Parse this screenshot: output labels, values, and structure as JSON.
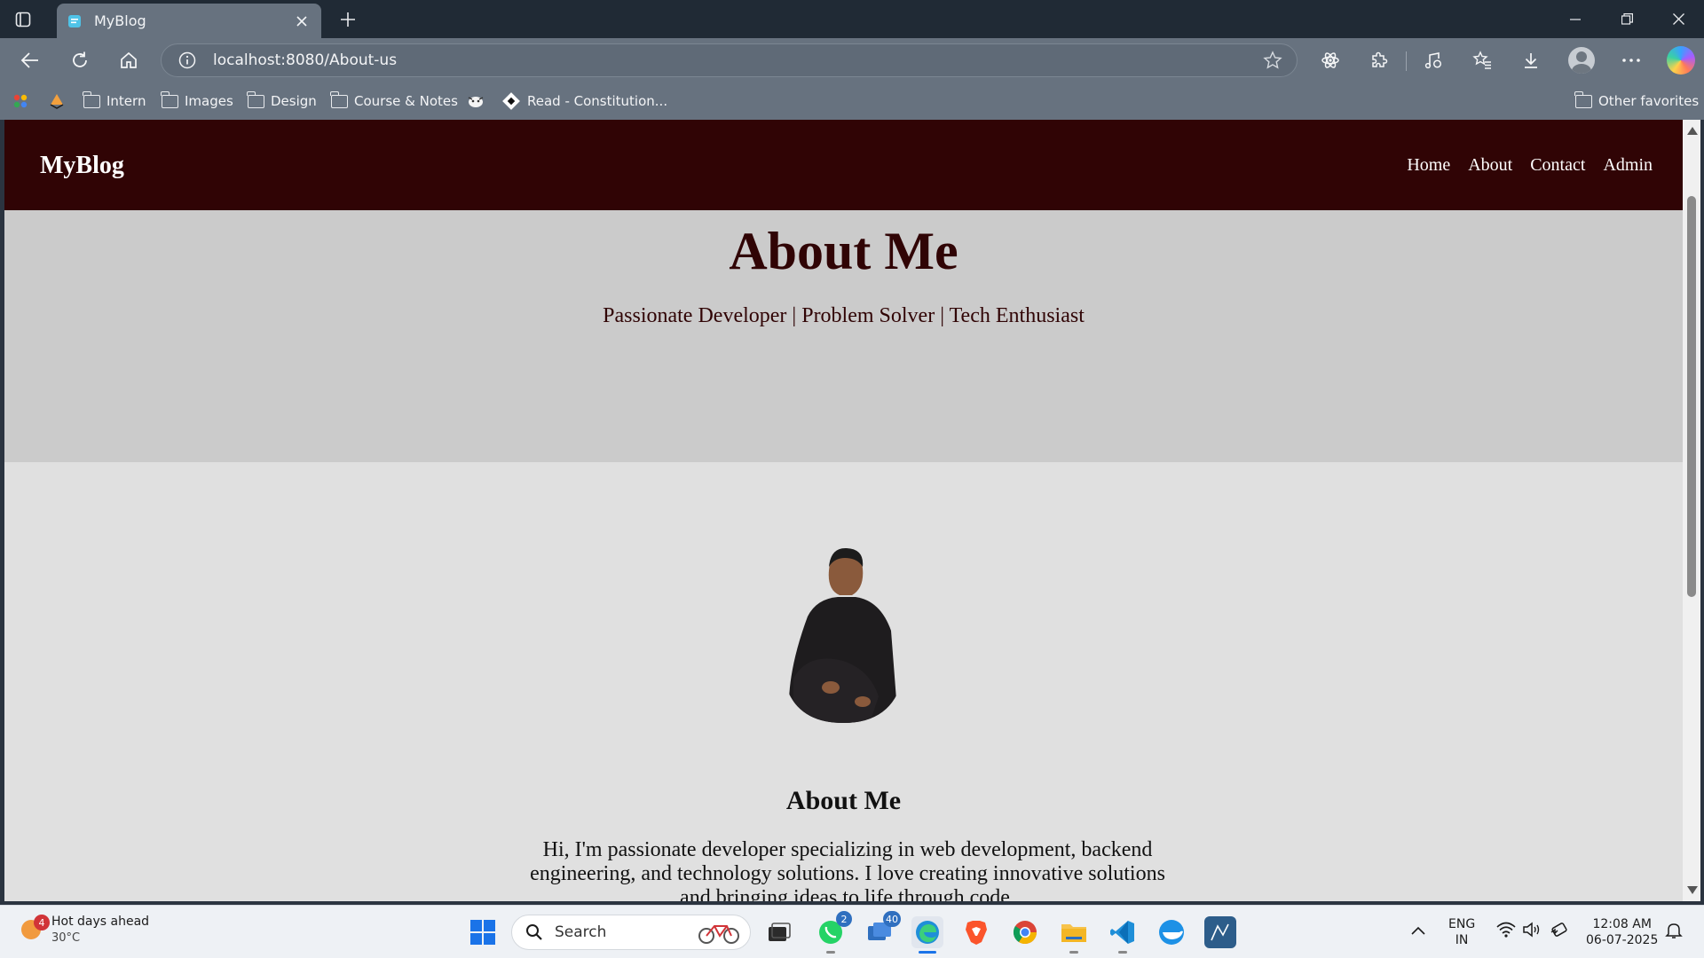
{
  "browser": {
    "tab": {
      "title": "MyBlog",
      "favicon": "blog-favicon-icon"
    },
    "address_bar": {
      "url": "localhost:8080/About-us"
    },
    "bookmarks": [
      {
        "label": "Intern",
        "type": "folder"
      },
      {
        "label": "Images",
        "type": "folder"
      },
      {
        "label": "Design",
        "type": "folder"
      },
      {
        "label": "Course & Notes",
        "type": "folder"
      },
      {
        "label": "Read - Constitution...",
        "type": "link"
      }
    ],
    "other_favorites": "Other favorites"
  },
  "site": {
    "brand": "MyBlog",
    "nav": [
      "Home",
      "About",
      "Contact",
      "Admin"
    ],
    "hero": {
      "title": "About Me",
      "tagline": "Passionate Developer | Problem Solver | Tech Enthusiast"
    },
    "about": {
      "heading": "About Me",
      "paragraph": "Hi, I'm passionate developer specializing in web development, backend engineering, and technology solutions. I love creating innovative solutions and bringing ideas to life through code."
    },
    "colors": {
      "nav_bg": "#300405",
      "hero_bg": "#cbcbcb",
      "page_bg": "#e0e0e0",
      "accent": "#300405"
    }
  },
  "taskbar": {
    "weather": {
      "badge": "4",
      "title": "Hot days ahead",
      "temp": "30°C"
    },
    "search_placeholder": "Search",
    "whatsapp_badge": "2",
    "teams_badge": "40",
    "language": {
      "line1": "ENG",
      "line2": "IN"
    },
    "clock": {
      "time": "12:08 AM",
      "date": "06-07-2025"
    }
  }
}
